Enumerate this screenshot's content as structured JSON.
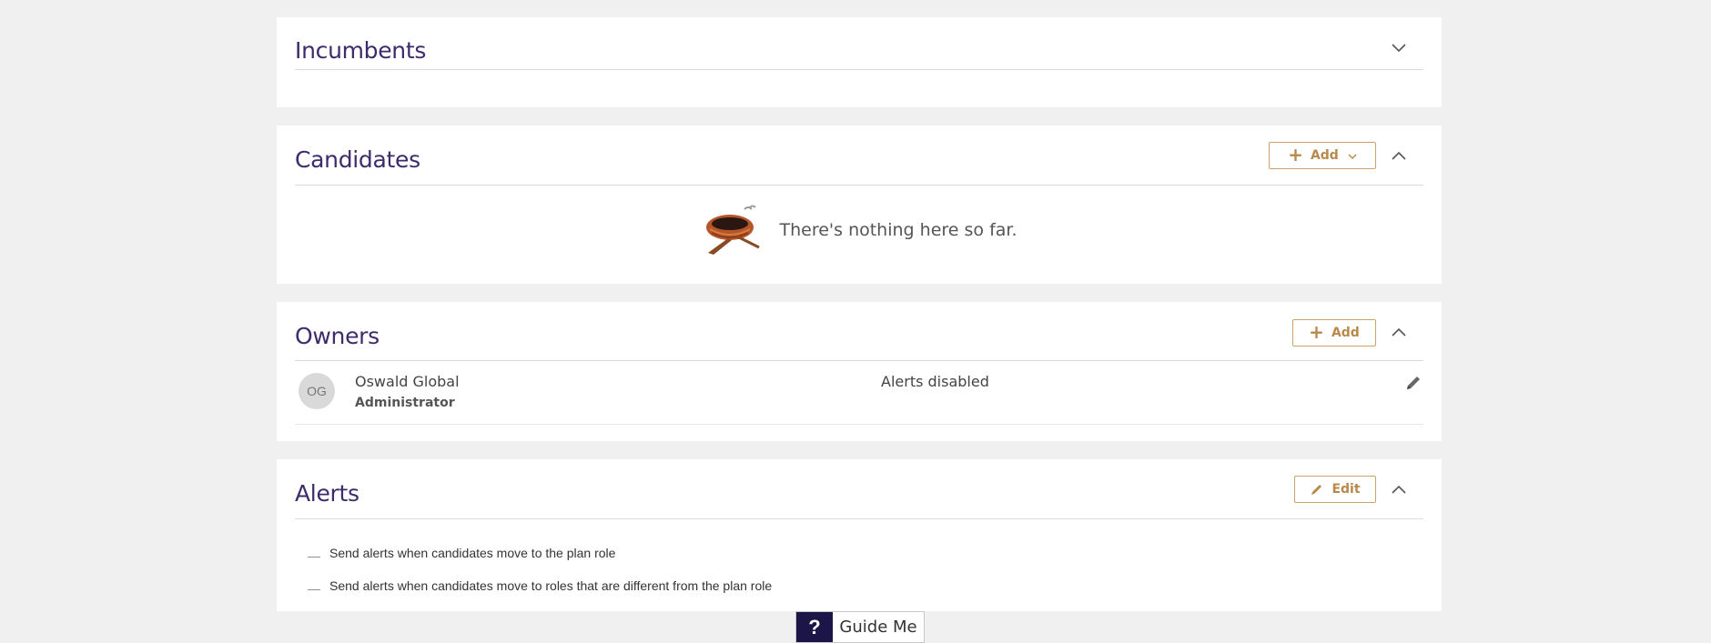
{
  "incumbents": {
    "title": "Incumbents"
  },
  "candidates": {
    "title": "Candidates",
    "add_label": "Add",
    "empty_text": "There's nothing here so far."
  },
  "owners": {
    "title": "Owners",
    "add_label": "Add",
    "items": [
      {
        "initials": "OG",
        "name": "Oswald Global",
        "role": "Administrator",
        "alert_status": "Alerts disabled"
      }
    ]
  },
  "alerts": {
    "title": "Alerts",
    "edit_label": "Edit",
    "items": [
      {
        "bullet": "—",
        "text": "Send alerts when candidates move to the plan role"
      },
      {
        "bullet": "—",
        "text": "Send alerts when candidates move to roles that are different from the plan role"
      }
    ]
  },
  "guide": {
    "icon": "?",
    "label": "Guide Me"
  },
  "colors": {
    "title": "#3d2b6b",
    "accent": "#b8894a",
    "accent_border": "#c9a46a",
    "guide_bg": "#1b1548"
  }
}
